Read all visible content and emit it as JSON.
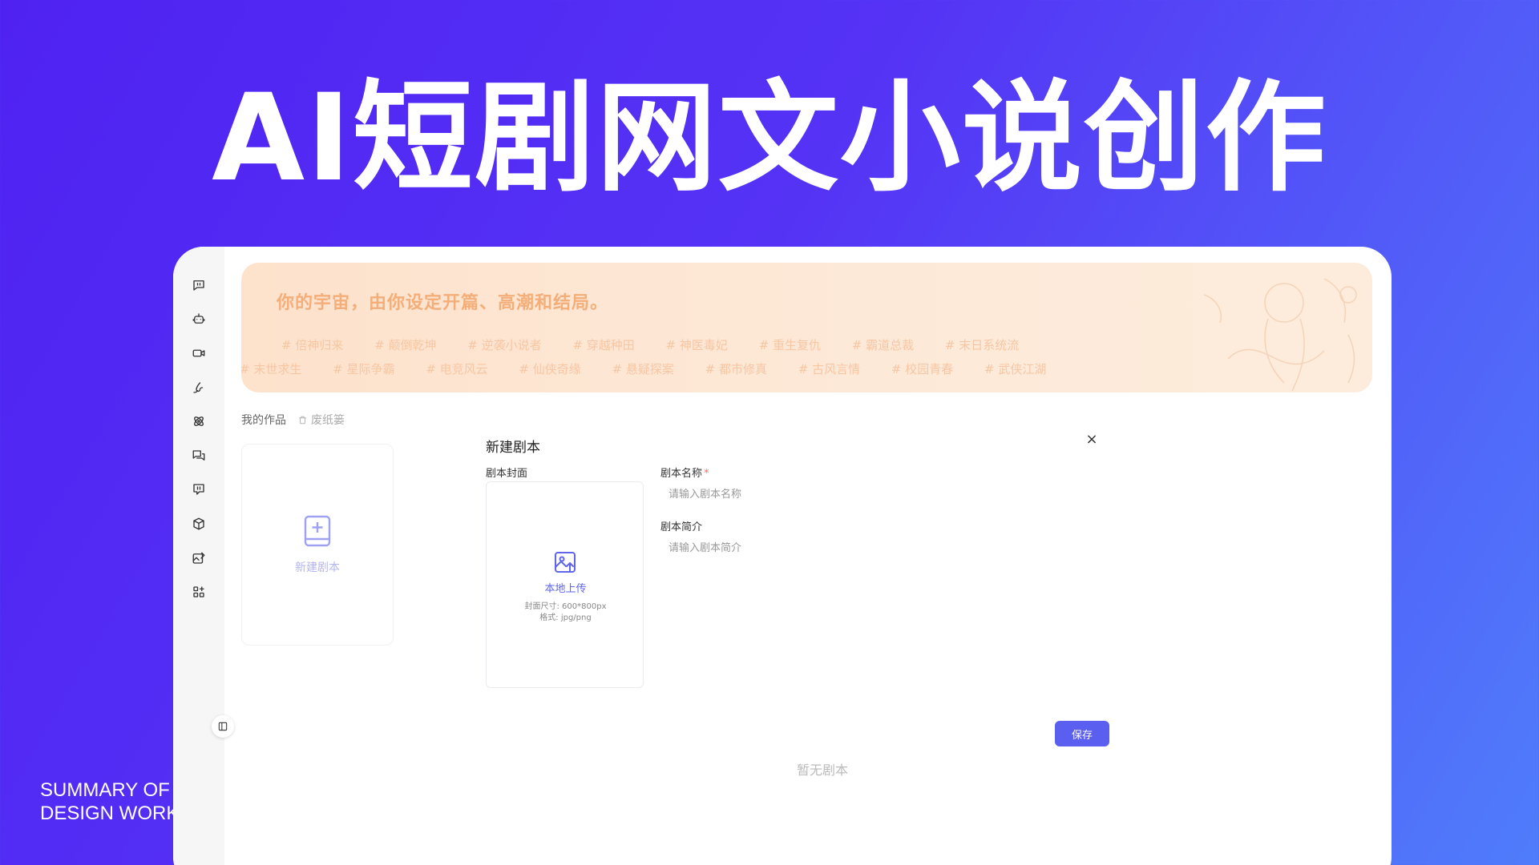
{
  "hero": {
    "title": "AI短剧网文小说创作"
  },
  "caption": {
    "line1": "SUMMARY OF",
    "line2": "DESIGN WORK"
  },
  "sidebar": {
    "items": [
      {
        "icon": "chat-quote-icon"
      },
      {
        "icon": "robot-icon"
      },
      {
        "icon": "video-camera-icon"
      },
      {
        "icon": "brush-icon"
      },
      {
        "icon": "atom-icon"
      },
      {
        "icon": "chat-bubbles-icon"
      },
      {
        "icon": "comment-box-icon"
      },
      {
        "icon": "cube-icon"
      },
      {
        "icon": "image-edit-icon"
      },
      {
        "icon": "apps-grid-icon"
      }
    ],
    "collapse_icon": "sidebar-collapse-icon"
  },
  "banner": {
    "slogan": "你的宇宙，由你设定开篇、高潮和结局。",
    "tags_row1": [
      "# 倍神归来",
      "# 颠倒乾坤",
      "# 逆袭小说者",
      "# 穿越种田",
      "# 神医毒妃",
      "# 重生复仇",
      "# 霸道总裁",
      "# 末日系统流"
    ],
    "tags_row2": [
      "# 末世求生",
      "# 星际争霸",
      "# 电竞风云",
      "# 仙侠奇缘",
      "# 悬疑探案",
      "# 都市修真",
      "# 古风言情",
      "# 校园青春",
      "# 武侠江湖"
    ]
  },
  "works": {
    "tab_mine": "我的作品",
    "tab_trash": "废纸篓",
    "new_card_label": "新建剧本",
    "empty_text": "暂无剧本"
  },
  "dialog": {
    "title": "新建剧本",
    "close": "×",
    "cover_label": "剧本封面",
    "upload_label": "本地上传",
    "upload_hint_size": "封面尺寸: 600*800px",
    "upload_hint_format": "格式: jpg/png",
    "name_label": "剧本名称",
    "name_required": "*",
    "name_placeholder": "请输入剧本名称",
    "desc_label": "剧本简介",
    "desc_placeholder": "请输入剧本简介",
    "save_label": "保存"
  },
  "colors": {
    "primary": "#5a5ff0",
    "background_start": "#4f22f2",
    "background_end": "#4f7dfb",
    "banner_tint": "#fde2cc"
  }
}
